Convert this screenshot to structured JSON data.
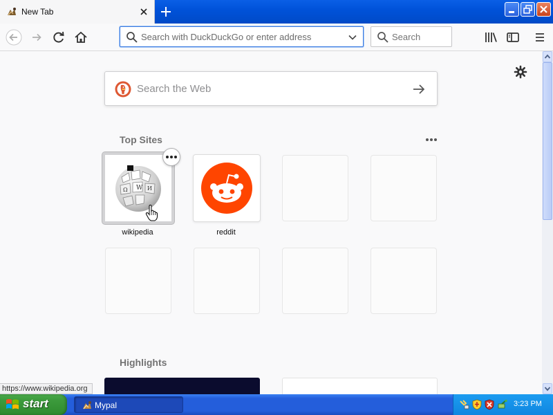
{
  "window": {
    "tab_title": "New Tab",
    "tab_favicon": "mypal-favicon-icon"
  },
  "toolbar": {
    "url_placeholder": "Search with DuckDuckGo or enter address",
    "search_placeholder": "Search"
  },
  "newtab": {
    "web_search_placeholder": "Search the Web",
    "top_sites_title": "Top Sites",
    "highlights_title": "Highlights",
    "top_sites": [
      {
        "label": "wikipedia"
      },
      {
        "label": "reddit"
      }
    ],
    "empty_tile_count": 6
  },
  "status_url": "https://www.wikipedia.org",
  "taskbar": {
    "start_label": "start",
    "task_label": "Mypal",
    "clock": "3:23 PM"
  },
  "colors": {
    "accent": "#0060df",
    "reddit": "#ff4500",
    "xp_taskbar": "#245edb",
    "xp_start": "#3c9a3c",
    "duckduckgo": "#de5833"
  }
}
